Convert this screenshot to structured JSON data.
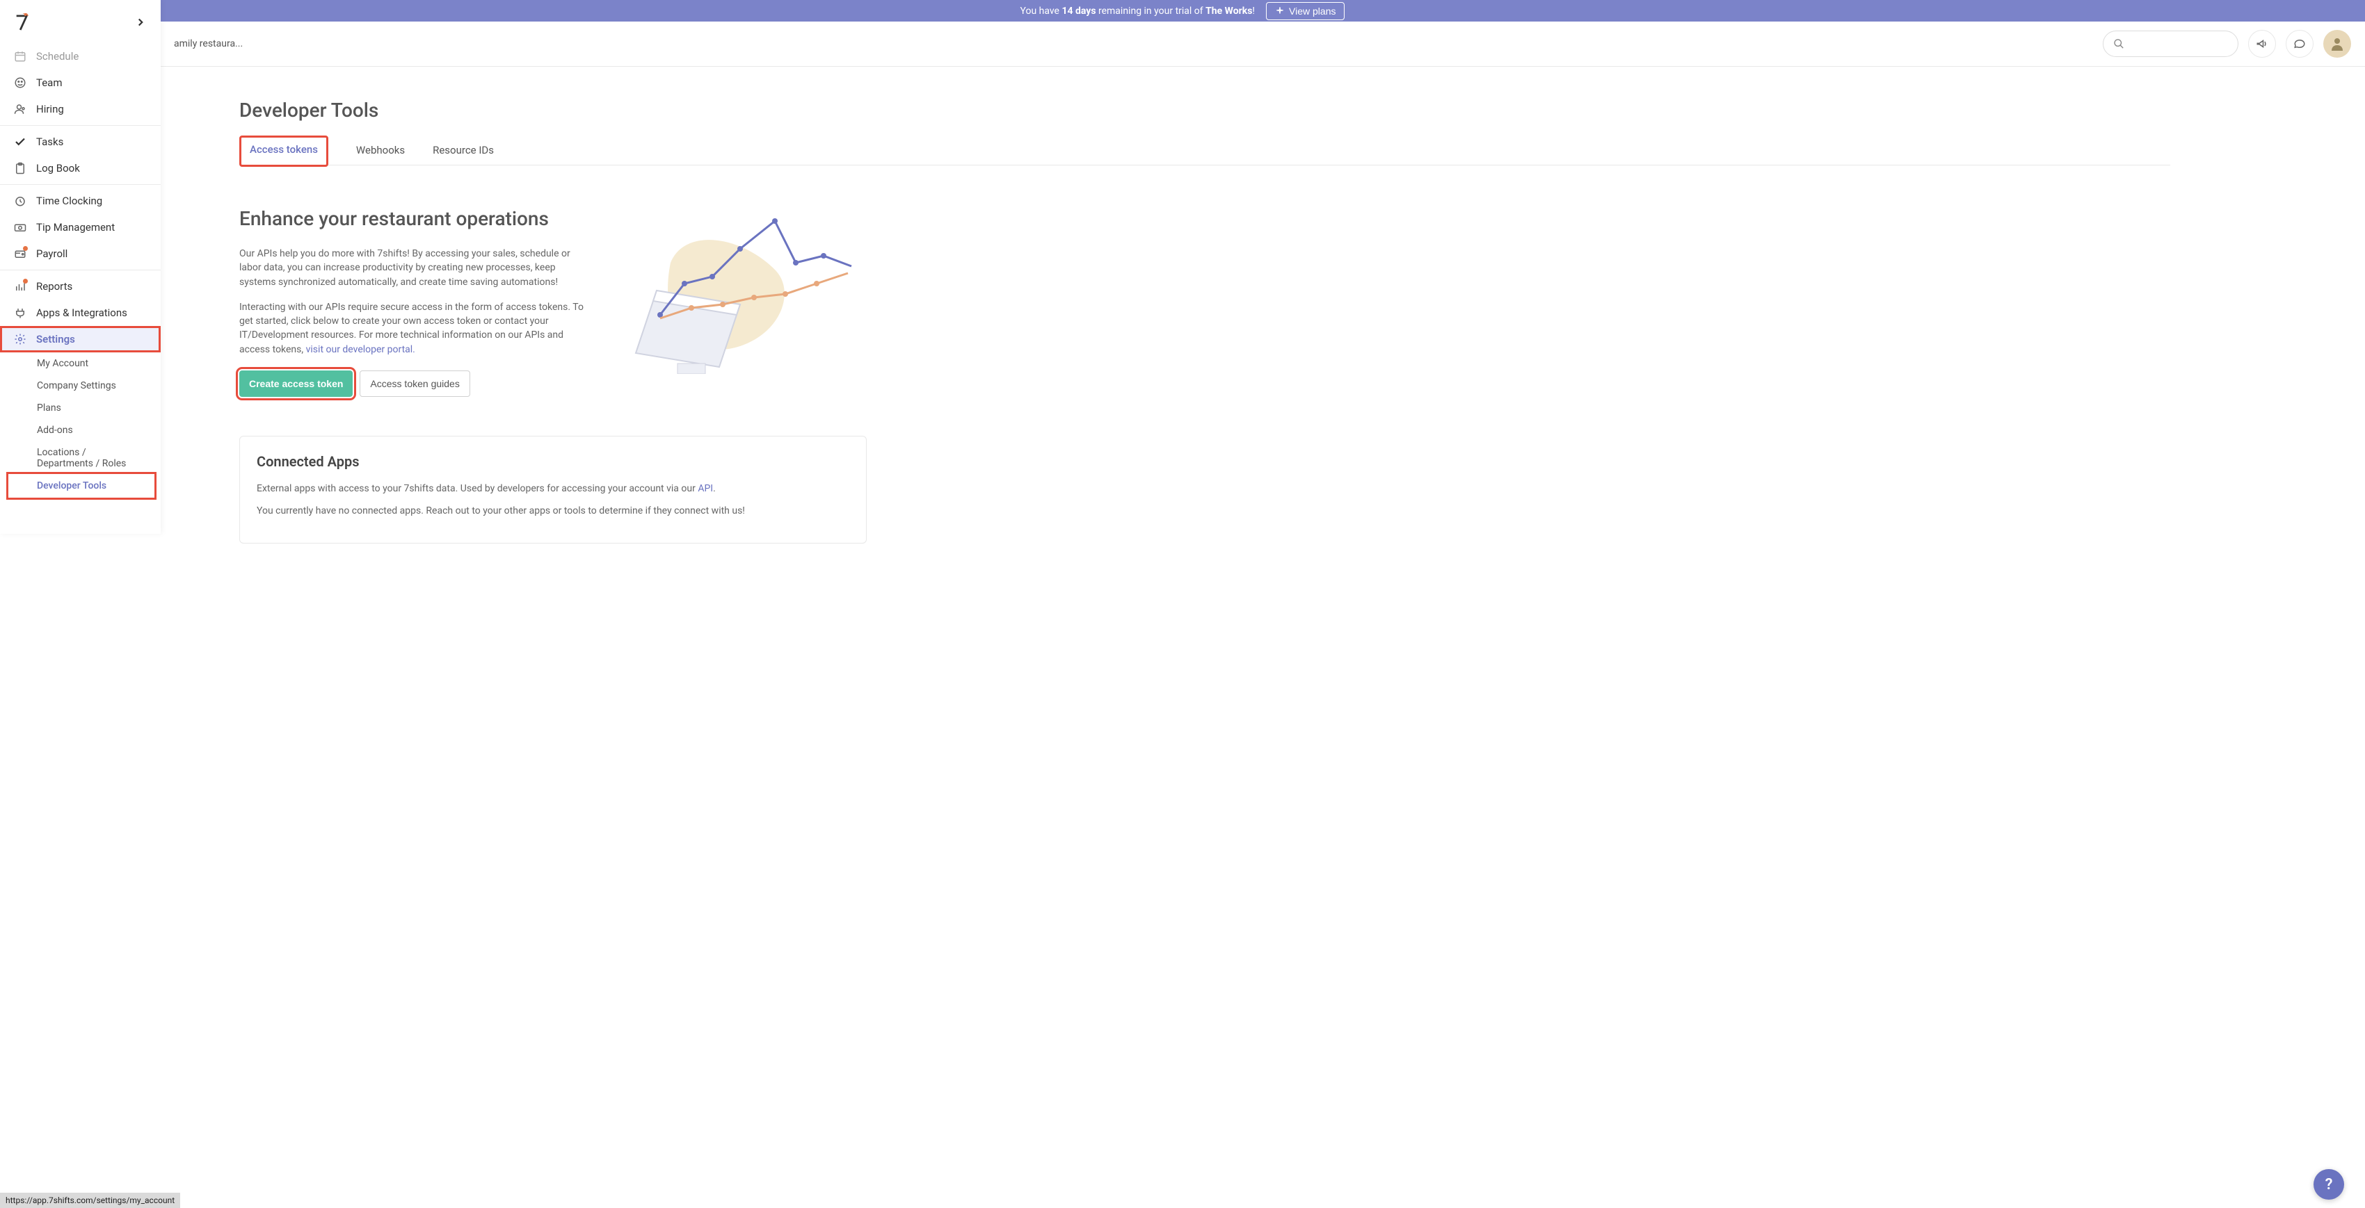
{
  "banner": {
    "text_prefix": "You have ",
    "days": "14 days",
    "text_mid": " remaining in your trial of ",
    "plan": "The Works",
    "button_label": "View plans"
  },
  "topbar": {
    "breadcrumb": "amily restaura...",
    "search_placeholder": ""
  },
  "sidebar": {
    "items": [
      {
        "icon": "calendar",
        "label": "Schedule",
        "dot": false
      },
      {
        "icon": "smiley",
        "label": "Team",
        "dot": false
      },
      {
        "icon": "people",
        "label": "Hiring",
        "dot": false
      }
    ],
    "group2": [
      {
        "icon": "check",
        "label": "Tasks"
      },
      {
        "icon": "clipboard",
        "label": "Log Book"
      }
    ],
    "group3": [
      {
        "icon": "clock",
        "label": "Time Clocking"
      },
      {
        "icon": "money",
        "label": "Tip Management"
      },
      {
        "icon": "wallet",
        "label": "Payroll",
        "dot": true
      }
    ],
    "group4": [
      {
        "icon": "chart",
        "label": "Reports",
        "dot": true
      },
      {
        "icon": "plug",
        "label": "Apps & Integrations"
      },
      {
        "icon": "gear",
        "label": "Settings",
        "active": true
      }
    ],
    "sub_items": [
      {
        "label": "My Account"
      },
      {
        "label": "Company Settings"
      },
      {
        "label": "Plans"
      },
      {
        "label": "Add-ons"
      },
      {
        "label": "Locations / Departments / Roles"
      },
      {
        "label": "Developer Tools",
        "active": true
      }
    ]
  },
  "page": {
    "title": "Developer Tools",
    "tabs": [
      {
        "label": "Access tokens",
        "active": true
      },
      {
        "label": "Webhooks"
      },
      {
        "label": "Resource IDs"
      }
    ],
    "hero_title": "Enhance your restaurant operations",
    "hero_p1": "Our APIs help you do more with 7shifts! By accessing your sales, schedule or labor data, you can increase productivity by creating new processes, keep systems synchronized automatically, and create time saving automations!",
    "hero_p2": "Interacting with our APIs require secure access in the form of access tokens. To get started, click below to create your own access token or contact your IT/Development resources. For more technical information on our APIs and access tokens, ",
    "hero_link": "visit our developer portal.",
    "create_btn": "Create access token",
    "guides_btn": "Access token guides",
    "card_title": "Connected Apps",
    "card_p1_pre": "External apps with access to your 7shifts data. Used by developers for accessing your account via our ",
    "card_p1_link": "API",
    "card_p1_post": ".",
    "card_p2": "You currently have no connected apps. Reach out to your other apps or tools to determine if they connect with us!"
  },
  "statusbar": "https://app.7shifts.com/settings/my_account",
  "help": "?"
}
